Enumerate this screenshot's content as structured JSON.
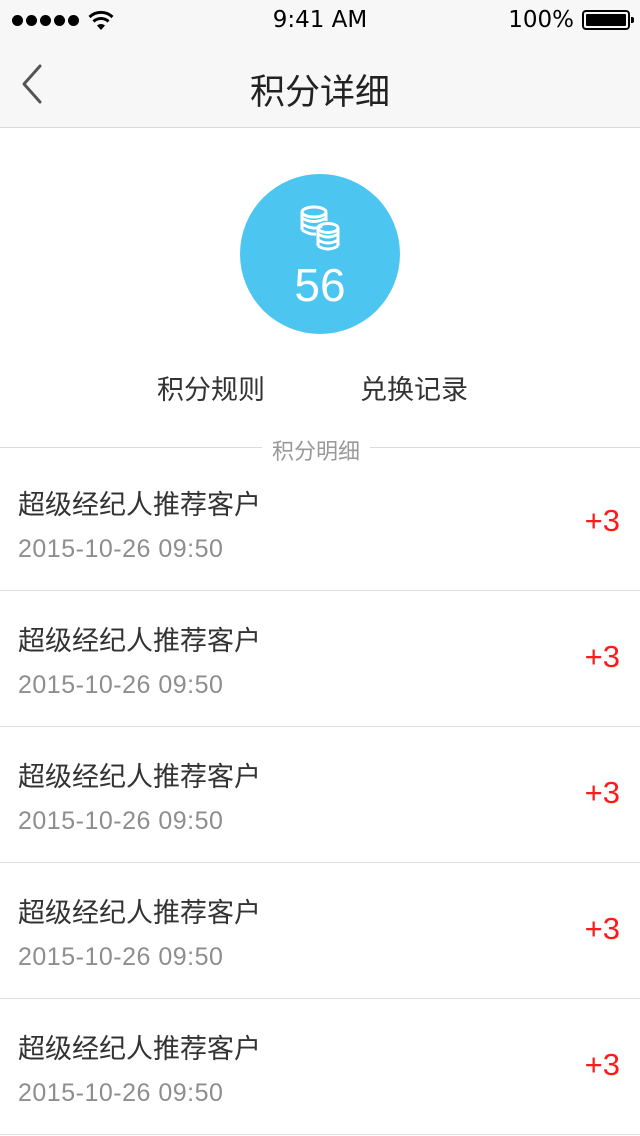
{
  "status_bar": {
    "time": "9:41 AM",
    "battery": "100%"
  },
  "nav": {
    "title": "积分详细"
  },
  "points": {
    "value": "56"
  },
  "links": {
    "rules": "积分规则",
    "records": "兑换记录"
  },
  "section": {
    "label": "积分明细"
  },
  "records": [
    {
      "title": "超级经纪人推荐客户",
      "date": "2015-10-26  09:50",
      "points": "+3"
    },
    {
      "title": "超级经纪人推荐客户",
      "date": "2015-10-26  09:50",
      "points": "+3"
    },
    {
      "title": "超级经纪人推荐客户",
      "date": "2015-10-26  09:50",
      "points": "+3"
    },
    {
      "title": "超级经纪人推荐客户",
      "date": "2015-10-26  09:50",
      "points": "+3"
    },
    {
      "title": "超级经纪人推荐客户",
      "date": "2015-10-26  09:50",
      "points": "+3"
    }
  ],
  "colors": {
    "accent": "#4cc6f0",
    "points_positive": "#ff1a1a"
  }
}
